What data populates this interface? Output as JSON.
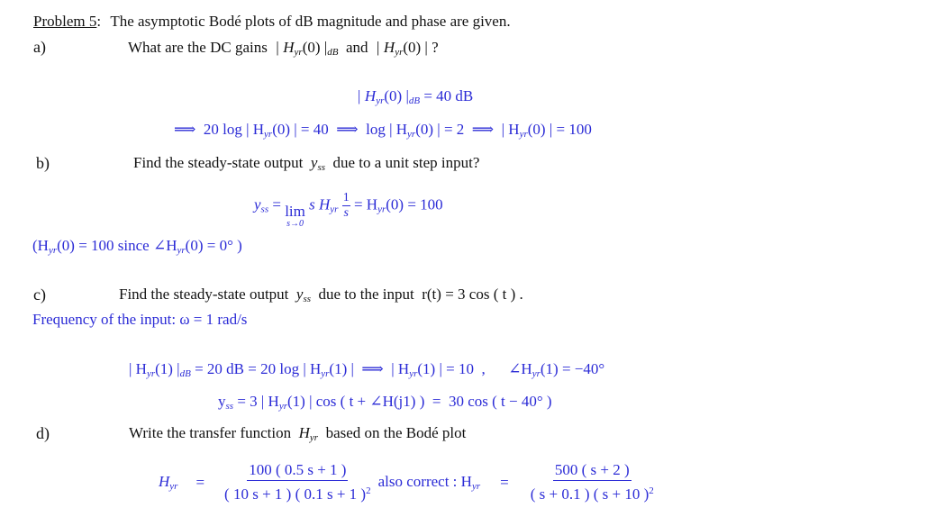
{
  "problem": {
    "label": "Problem 5",
    "colon": ":",
    "statement": "The asymptotic Bodé plots of dB magnitude and phase are given."
  },
  "part_a": {
    "label": "a)",
    "question_prefix": "What are the DC gains",
    "question_expr1": "| H",
    "question_sub1": "yr",
    "question_expr1_tail": "(0) |",
    "question_sub1b": "dB",
    "question_and": "and",
    "question_expr2": "| H",
    "question_sub2": "yr",
    "question_expr2_tail": "(0) | ?",
    "answer_line1_lhs": "| H",
    "answer_line1_sub": "yr",
    "answer_line1_mid": "(0) |",
    "answer_line1_sub2": "dB",
    "answer_line1_rhs": " = 40 dB",
    "answer_line2": [
      {
        "text": "⟹  20 log | H"
      },
      {
        "sub": "yr"
      },
      {
        "text": "(0) | = 40  ⟹  log | H"
      },
      {
        "sub": "yr"
      },
      {
        "text": "(0) | = 2  ⟹  | H"
      },
      {
        "sub": "yr"
      },
      {
        "text": "(0) | = 100"
      }
    ]
  },
  "part_b": {
    "label": "b)",
    "question_prefix": "Find the steady-state output",
    "question_var": "y",
    "question_var_sub": "ss",
    "question_suffix": "due to a unit step input?",
    "answer_y": "y",
    "answer_y_sub": "ss",
    "answer_eq1": " = ",
    "answer_lim": "lim",
    "answer_lim_sub": "s→0",
    "answer_s": " s H",
    "answer_h_sub": "yr",
    "answer_frac_num": "1",
    "answer_frac_den": "s",
    "answer_rhs_a": " = H",
    "answer_rhs_sub": "yr",
    "answer_rhs_b": "(0) = 100",
    "note_a": "(H",
    "note_sub": "yr",
    "note_b": "(0)  =  100  since  ∠H",
    "note_sub2": "yr",
    "note_c": "(0) = 0° )"
  },
  "part_c": {
    "label": "c)",
    "question_prefix": "Find the steady-state output",
    "question_var": "y",
    "question_var_sub": "ss",
    "question_mid": "due to the input",
    "question_input": "r(t)  =  3 cos ( t ) .",
    "freq_note": "Frequency of the input:  ω = 1 rad/s",
    "answer_line1": [
      {
        "text": "| H"
      },
      {
        "sub": "yr"
      },
      {
        "text": "(1) |"
      },
      {
        "sub": "dB"
      },
      {
        "text": " = 20 dB = 20 log | H"
      },
      {
        "sub": "yr"
      },
      {
        "text": "(1) |  ⟹  | H"
      },
      {
        "sub": "yr"
      },
      {
        "text": "(1) | = 10  ,      ∠H"
      },
      {
        "sub": "yr"
      },
      {
        "text": "(1) = −40°"
      }
    ],
    "answer_line2": [
      {
        "text": "y"
      },
      {
        "sub": "ss"
      },
      {
        "text": " = 3 | H"
      },
      {
        "sub": "yr"
      },
      {
        "text": "(1) | cos ( t + ∠H(j1) )  =  30 cos ( t − 40° )"
      }
    ]
  },
  "part_d": {
    "label": "d)",
    "question_prefix": "Write the transfer function",
    "question_var": "H",
    "question_var_sub": "yr",
    "question_suffix": "based on the Bodé plot",
    "tf1_lhs": "H",
    "tf1_lhs_sub": "yr",
    "tf1_eq": "=",
    "tf1_num": "100 ( 0.5 s + 1 )",
    "tf1_den": "( 10 s + 1 ) ( 0.1 s + 1 )",
    "tf1_den_exp": "2",
    "also_label": "also correct : H",
    "also_sub": "yr",
    "tf2_eq": "=",
    "tf2_num": "500 ( s + 2 )",
    "tf2_den": "( s + 0.1 ) ( s + 10 )",
    "tf2_den_exp": "2"
  },
  "colors": {
    "question_text": "#111111",
    "answer_text": "#2b2bd6"
  }
}
